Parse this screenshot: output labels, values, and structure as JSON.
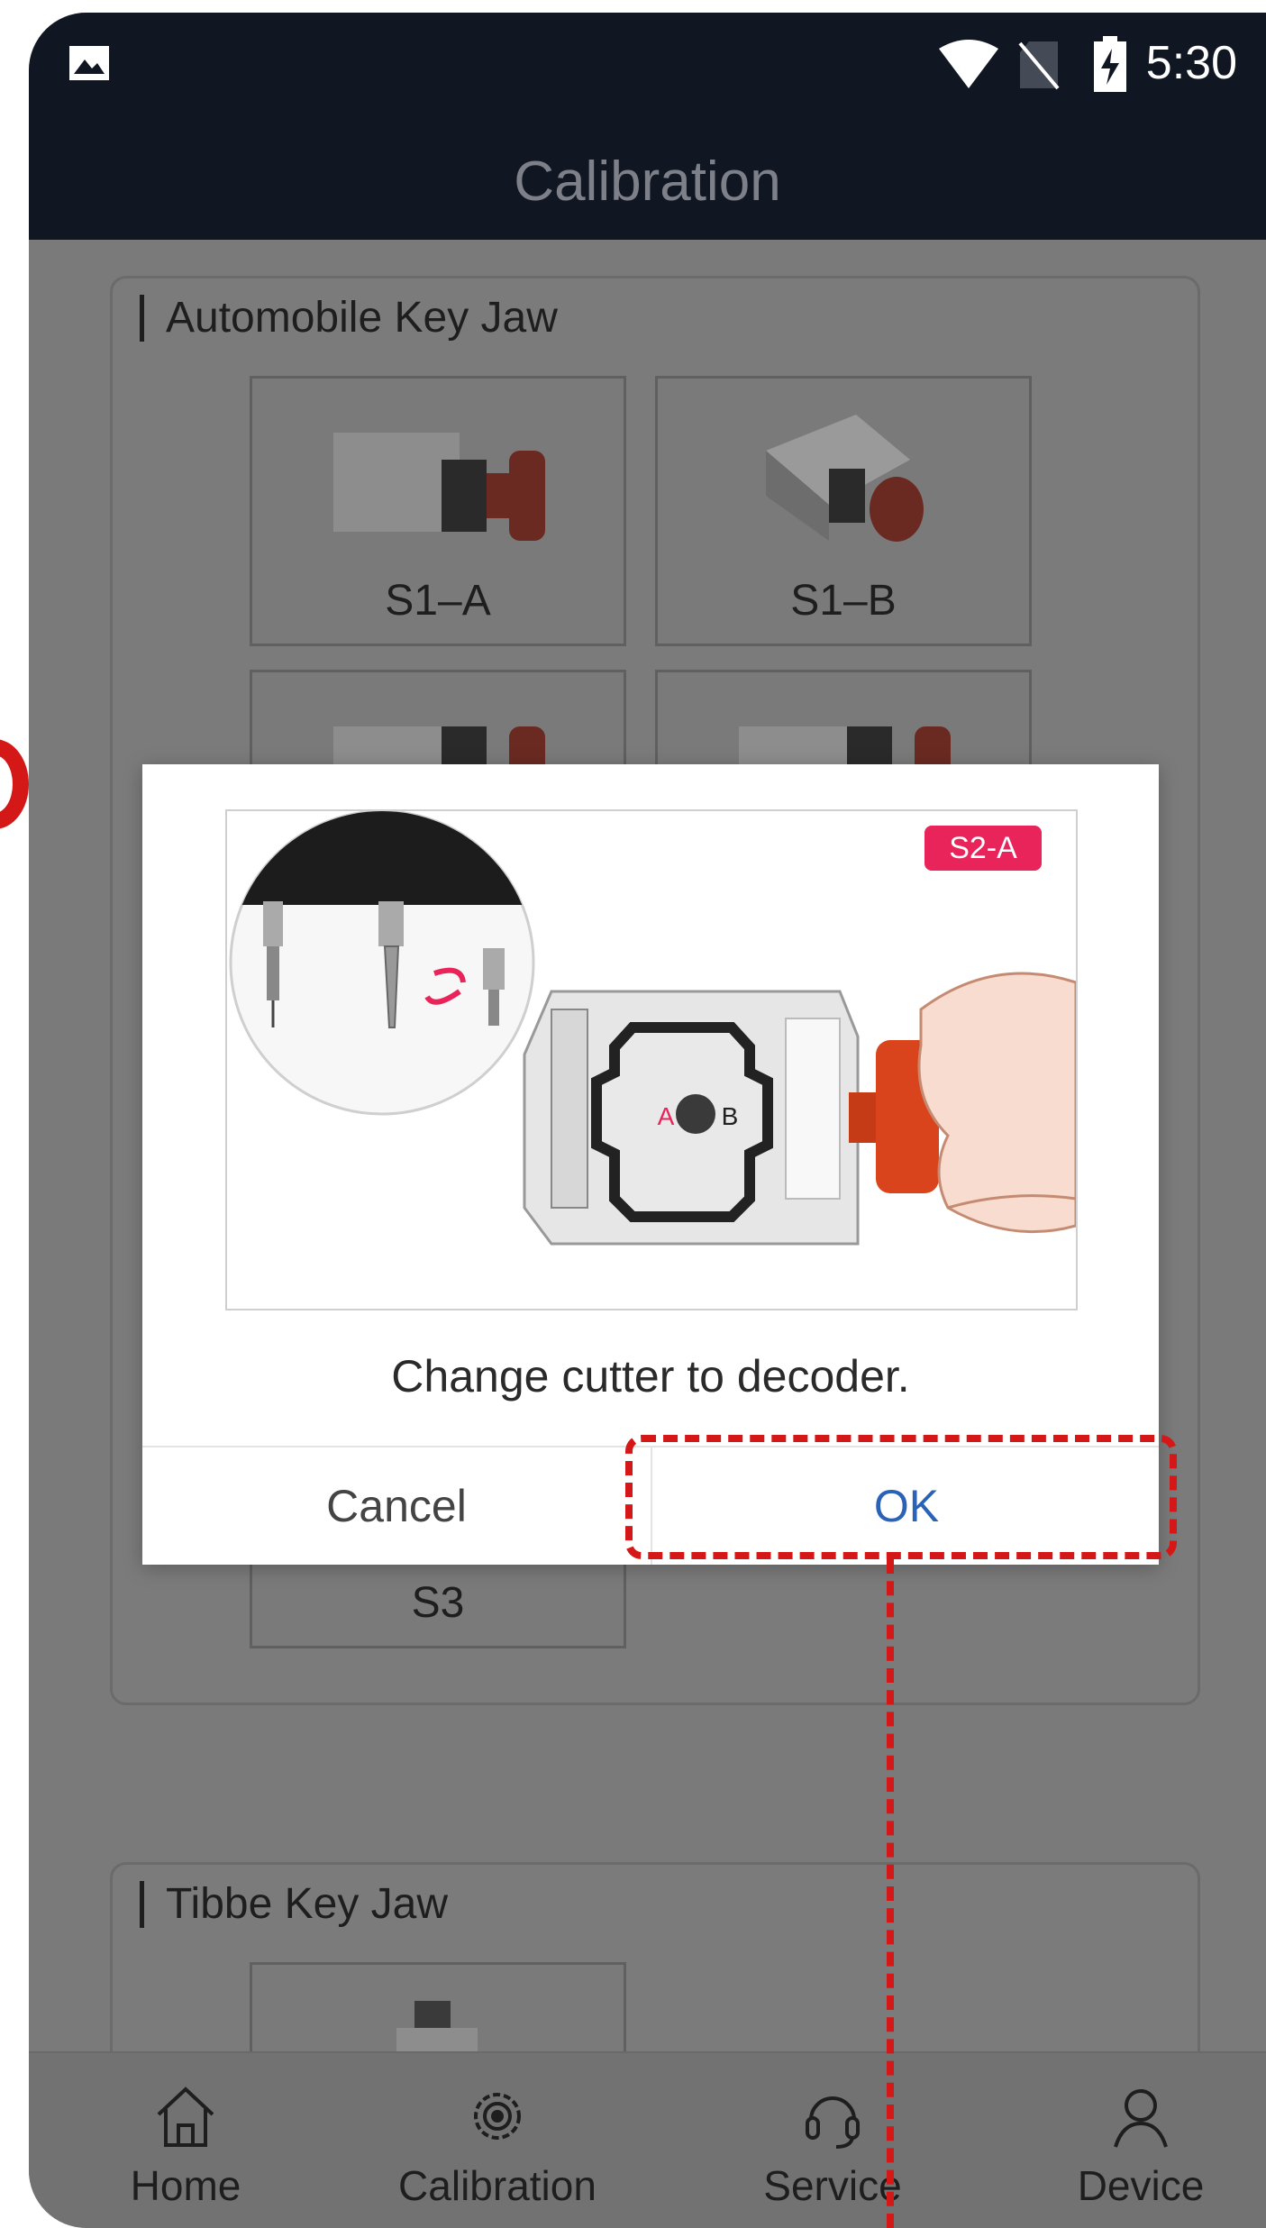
{
  "status_bar": {
    "time": "5:30",
    "icons": [
      "image-icon",
      "wifi-icon",
      "no-sim-icon",
      "battery-charging-icon"
    ]
  },
  "app_bar": {
    "title": "Calibration"
  },
  "sections": [
    {
      "title": "Automobile Key Jaw",
      "tiles": [
        "S1–A",
        "S1–B"
      ]
    },
    {
      "title": "",
      "tiles": [
        "S3"
      ]
    },
    {
      "title": "Tibbe Key Jaw",
      "tiles": [
        ""
      ]
    }
  ],
  "dialog": {
    "badge": "S2-A",
    "jaw_letters": {
      "a": "A",
      "b": "B"
    },
    "message": "Change cutter to decoder.",
    "cancel_label": "Cancel",
    "ok_label": "OK"
  },
  "bottom_nav": {
    "items": [
      {
        "label": "Home",
        "icon": "home-icon"
      },
      {
        "label": "Calibration",
        "icon": "gear-icon"
      },
      {
        "label": "Service",
        "icon": "headset-icon"
      },
      {
        "label": "Device",
        "icon": "user-icon"
      }
    ]
  },
  "colors": {
    "accent_blue": "#2a62b8",
    "highlight_red": "#d41818",
    "badge_pink": "#e8245a",
    "knob_orange": "#d9441c",
    "appbar_dark": "#111722"
  }
}
